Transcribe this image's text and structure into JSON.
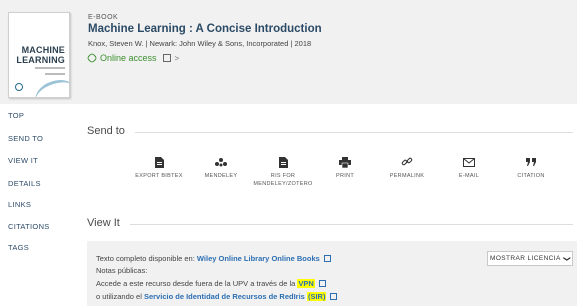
{
  "record": {
    "cover": {
      "title_line1": "MACHINE",
      "title_line2": "LEARNING"
    },
    "type": "E-BOOK",
    "title": "Machine Learning : A Concise Introduction",
    "meta": "Knox, Steven W. | Newark: John Wiley & Sons, Incorporated | 2018",
    "access_label": "Online access",
    "access_chevron": ">"
  },
  "nav": {
    "items": [
      {
        "label": "TOP"
      },
      {
        "label": "SEND TO"
      },
      {
        "label": "VIEW IT"
      },
      {
        "label": "DETAILS"
      },
      {
        "label": "LINKS"
      },
      {
        "label": "CITATIONS"
      },
      {
        "label": "TAGS"
      }
    ]
  },
  "send_to": {
    "heading": "Send to",
    "actions": [
      {
        "label": "EXPORT BIBTEX",
        "icon": "file-icon"
      },
      {
        "label": "MENDELEY",
        "icon": "mendeley-icon"
      },
      {
        "label": "RIS FOR MENDELEY/ZOTERO",
        "icon": "file-icon"
      },
      {
        "label": "PRINT",
        "icon": "print-icon"
      },
      {
        "label": "PERMALINK",
        "icon": "link-icon"
      },
      {
        "label": "E-MAIL",
        "icon": "mail-icon"
      },
      {
        "label": "CITATION",
        "icon": "quote-icon"
      }
    ]
  },
  "view_it": {
    "heading": "View It",
    "fulltext_prefix": "Texto completo disponible en:",
    "fulltext_link": "Wiley Online Library Online Books",
    "notes_label": "Notas públicas:",
    "vpn_prefix": "Accede a este recurso desde fuera de la UPV a través de la",
    "vpn_link": "VPN",
    "sir_prefix": "o utilizando el",
    "sir_link": "Servicio de Identidad de Recursos de RedIris",
    "sir_abbr": "(SIR)",
    "license_button": "MOSTRAR LICENCIA",
    "license_caret": "❯"
  },
  "colors": {
    "accent": "#2d6fb3",
    "access_green": "#3d8f2e",
    "highlight": "#ffff00"
  }
}
